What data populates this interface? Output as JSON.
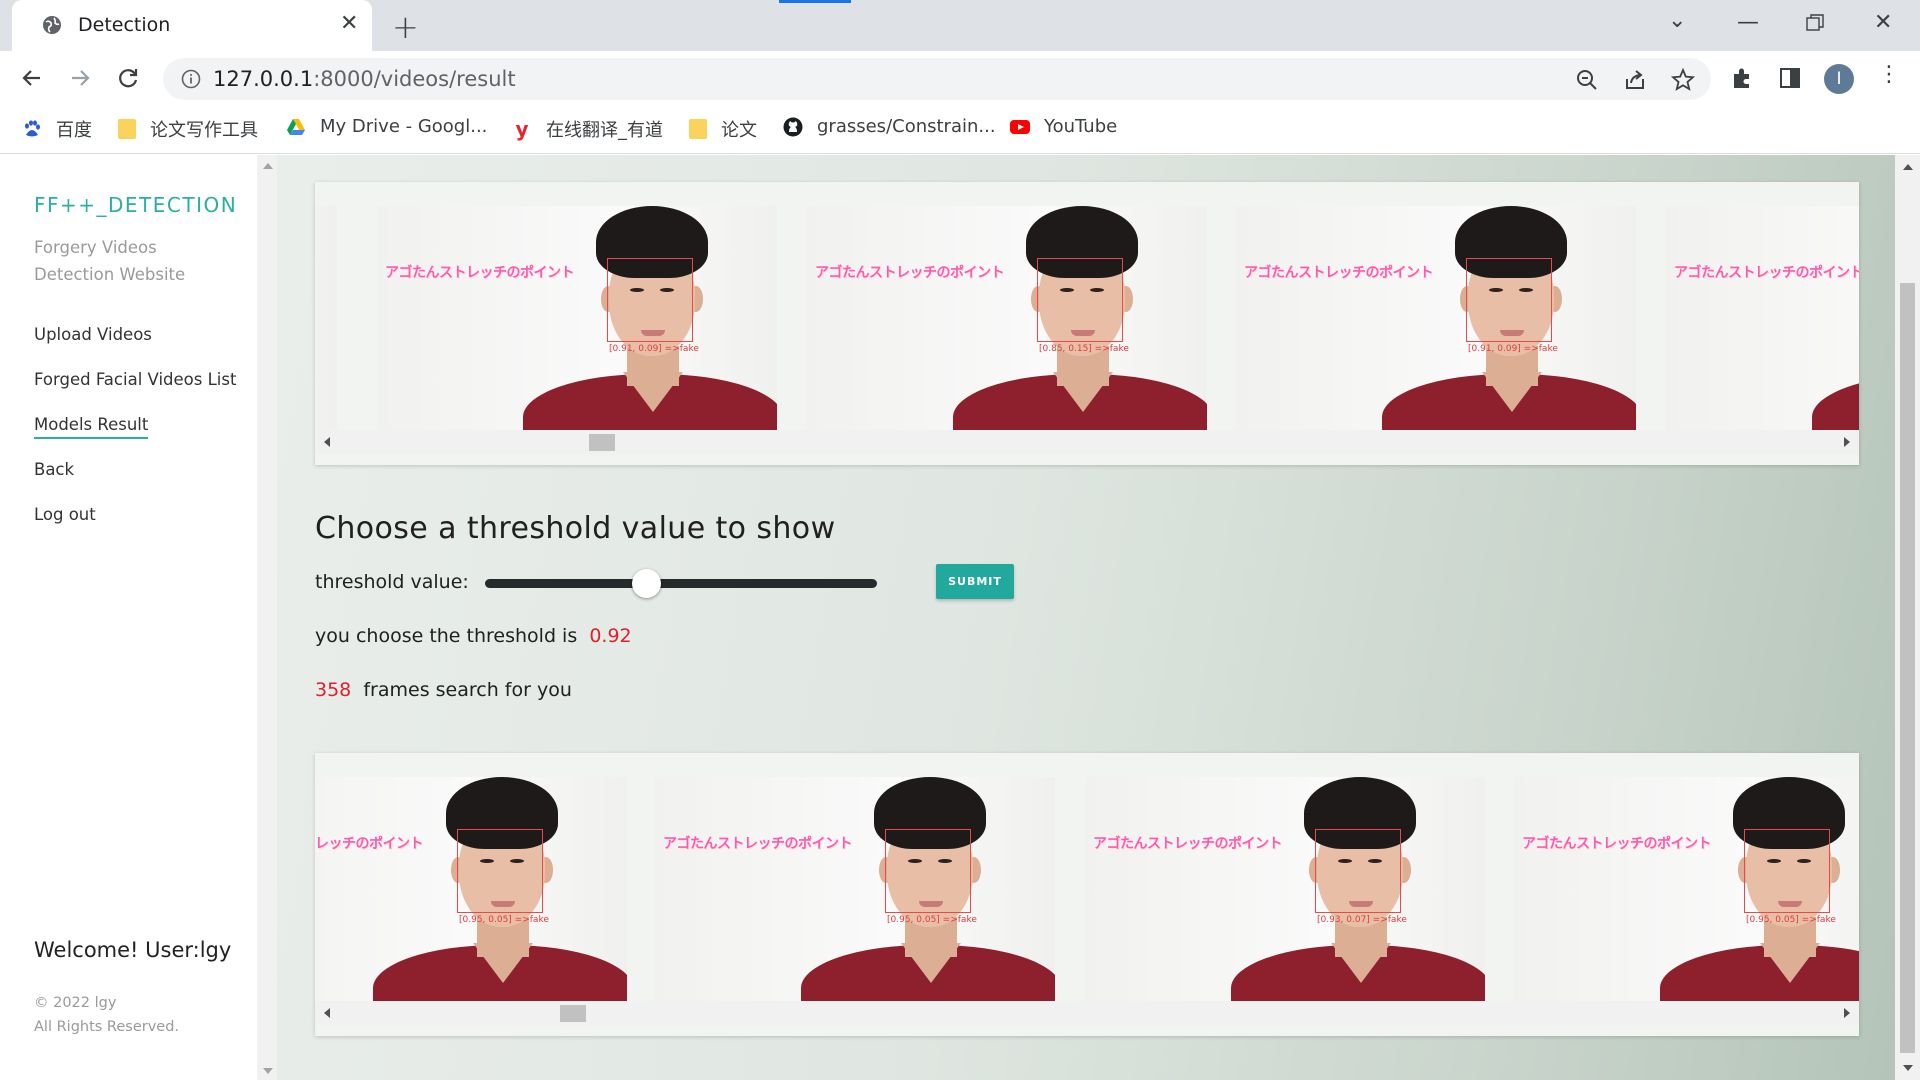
{
  "browser": {
    "tab_title": "Detection",
    "url_host": "127.0.0.1",
    "url_path": ":8000/videos/result",
    "bookmarks": [
      {
        "label": "百度",
        "icon": "baidu-paw-icon"
      },
      {
        "label": "论文写作工具",
        "icon": "folder-icon"
      },
      {
        "label": "My Drive - Googl...",
        "icon": "google-drive-icon"
      },
      {
        "label": "在线翻译_有道",
        "icon": "youdao-icon"
      },
      {
        "label": "论文",
        "icon": "folder-icon"
      },
      {
        "label": "grasses/Constrain...",
        "icon": "github-icon"
      },
      {
        "label": "YouTube",
        "icon": "youtube-icon"
      }
    ],
    "avatar_letter": "I"
  },
  "sidebar": {
    "brand": "FF++_DETECTION",
    "subtitle_line1": "Forgery Videos",
    "subtitle_line2": "Detection Website",
    "nav": [
      {
        "label": "Upload Videos",
        "active": false
      },
      {
        "label": "Forged Facial Videos List",
        "active": false
      },
      {
        "label": "Models Result",
        "active": true
      },
      {
        "label": "Back",
        "active": false
      },
      {
        "label": "Log out",
        "active": false
      }
    ],
    "welcome": "Welcome! User:lgy",
    "copyright": "© 2022 lgy",
    "rights": "All Rights Reserved."
  },
  "carousel_top": {
    "frames": [
      {
        "caption": "アゴたんストレッチのポイント",
        "label": "[0.91, 0.09] =>fake"
      },
      {
        "caption": "アゴたんストレッチのポイント",
        "label": "[0.85, 0.15] =>fake"
      },
      {
        "caption": "アゴたんストレッチのポイント",
        "label": "[0.91, 0.09] =>fake"
      },
      {
        "caption": "アゴたんストレッチのポイント",
        "label": ""
      }
    ],
    "scroll_position": 0.17
  },
  "threshold": {
    "title": "Choose a threshold value to show",
    "label": "threshold value:",
    "value": 0.92,
    "slider_fraction": 0.41,
    "submit_label": "SUBMIT",
    "choose_text": "you choose the threshold is",
    "choose_value": "0.92",
    "frames_count": "358",
    "frames_text": "frames search for you"
  },
  "carousel_bottom": {
    "frames": [
      {
        "caption": "レッチのポイント",
        "label": "[0.95, 0.05] =>fake"
      },
      {
        "caption": "アゴたんストレッチのポイント",
        "label": "[0.95, 0.05] =>fake"
      },
      {
        "caption": "アゴたんストレッチのポイント",
        "label": "[0.93, 0.07] =>fake"
      },
      {
        "caption": "アゴたんストレッチのポイント",
        "label": "[0.95, 0.05] =>fake"
      }
    ],
    "scroll_position": 0.15
  },
  "colors": {
    "accent": "#2ab0a0",
    "highlight_red": "#e0202a",
    "tab_bg": "#dee1e6"
  }
}
